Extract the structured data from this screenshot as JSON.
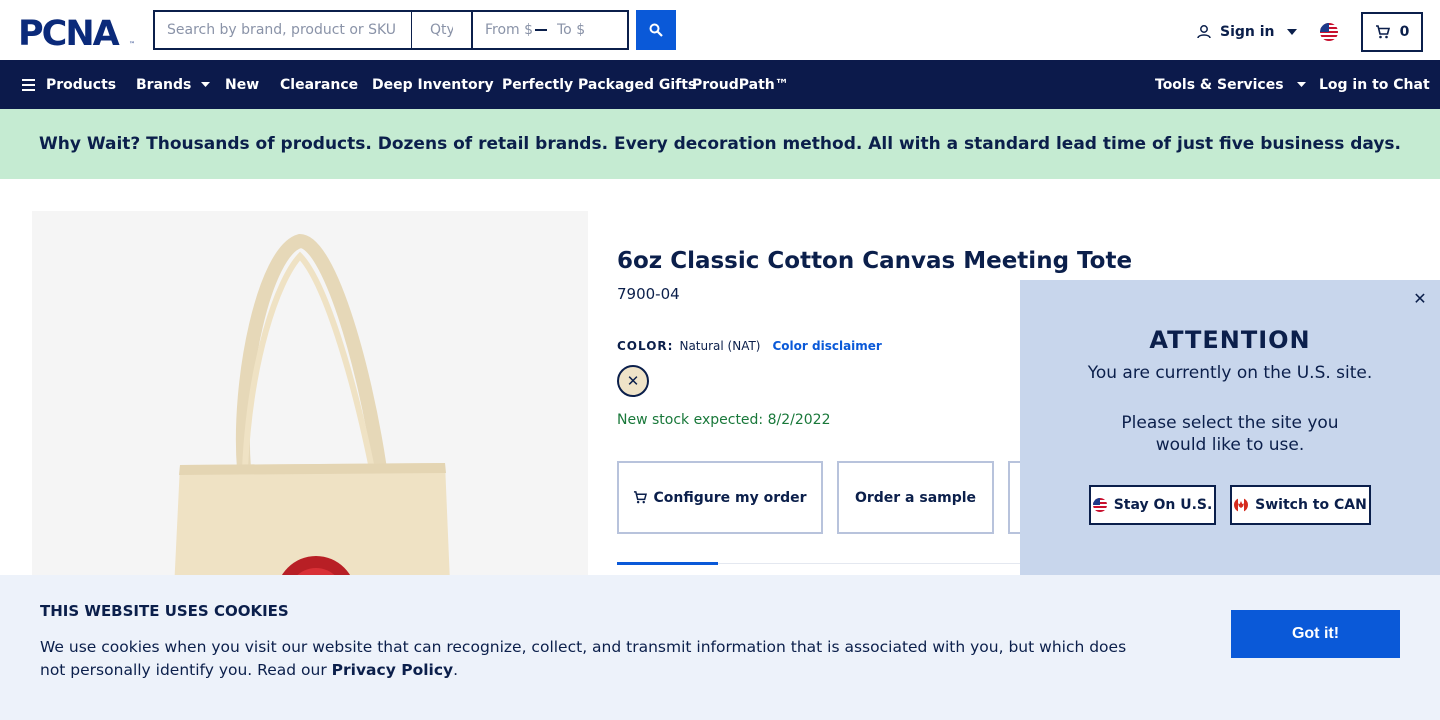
{
  "header": {
    "logo": "PCNA",
    "search_placeholder": "Search by brand, product or SKU",
    "qty_placeholder": "Qty",
    "price_from_placeholder": "From $",
    "price_to_placeholder": "To $",
    "signin_label": "Sign in",
    "cart_count": "0",
    "icons": [
      "search-icon",
      "user-icon",
      "chevron-down-icon",
      "us-flag-icon",
      "cart-icon"
    ]
  },
  "nav": {
    "items": [
      {
        "label": "Products"
      },
      {
        "label": "Brands"
      },
      {
        "label": "New"
      },
      {
        "label": "Clearance"
      },
      {
        "label": "Deep Inventory"
      },
      {
        "label": "Perfectly Packaged Gifts"
      },
      {
        "label": "ProudPath™"
      },
      {
        "label": "Tools & Services"
      },
      {
        "label": "Log in to Chat"
      }
    ]
  },
  "banner": {
    "text": "Why Wait? Thousands of products. Dozens of retail brands. Every decoration method. All with a standard lead time of just five business days."
  },
  "product": {
    "title": "6oz Classic Cotton Canvas Meeting Tote",
    "sku": "7900-04",
    "color_label": "COLOR:",
    "color_value": "Natural (NAT)",
    "color_disclaimer": "Color disclaimer",
    "stock_text": "New stock expected: 8/2/2022",
    "swatch_color": "#efe3c8",
    "configure_label": "Configure my order",
    "sample_label": "Order a sample"
  },
  "modal": {
    "title": "ATTENTION",
    "subtitle": "You are currently on the U.S. site.",
    "message": "Please select the site you would like to use.",
    "stay_label": "Stay On U.S.",
    "switch_label": "Switch to CAN"
  },
  "cookie": {
    "title": "THIS WEBSITE USES COOKIES",
    "text": "We use cookies when you visit our website that can recognize, collect, and transmit information that is associated with you, but which does not personally identify you. Read our ",
    "link": "Privacy Policy",
    "end": ".",
    "button": "Got it!"
  },
  "colors": {
    "navy": "#0c1a4b",
    "accent_blue": "#0a59d8",
    "banner_green": "#c5ebd2",
    "modal_bg": "#c8d6ec",
    "cookie_bg": "#edf2fa",
    "stock_green": "#19783a"
  }
}
